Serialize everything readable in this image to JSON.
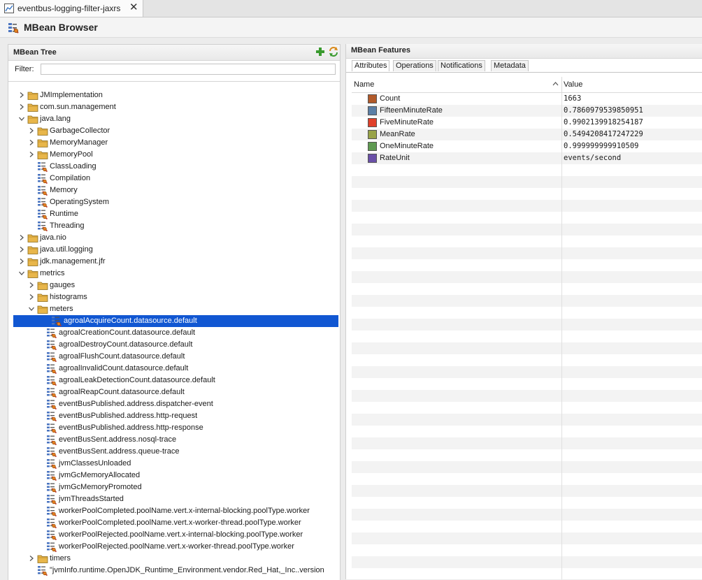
{
  "editor_tab": {
    "title": "eventbus-logging-filter-jaxrs",
    "close": "✕"
  },
  "page": {
    "title": "MBean Browser"
  },
  "mbean_tree": {
    "header": "MBean Tree",
    "filter_label": "Filter:",
    "filter_value": "",
    "rows": [
      {
        "label": "JMImplementation",
        "depth": 1,
        "kind": "folder",
        "twisty": "collapsed"
      },
      {
        "label": "com.sun.management",
        "depth": 1,
        "kind": "folder",
        "twisty": "collapsed"
      },
      {
        "label": "java.lang",
        "depth": 1,
        "kind": "folder",
        "twisty": "expanded"
      },
      {
        "label": "GarbageCollector",
        "depth": 2,
        "kind": "folder",
        "twisty": "collapsed"
      },
      {
        "label": "MemoryManager",
        "depth": 2,
        "kind": "folder",
        "twisty": "collapsed"
      },
      {
        "label": "MemoryPool",
        "depth": 2,
        "kind": "folder",
        "twisty": "collapsed"
      },
      {
        "label": "ClassLoading",
        "depth": 2,
        "kind": "bean",
        "twisty": "none"
      },
      {
        "label": "Compilation",
        "depth": 2,
        "kind": "bean",
        "twisty": "none"
      },
      {
        "label": "Memory",
        "depth": 2,
        "kind": "bean",
        "twisty": "none"
      },
      {
        "label": "OperatingSystem",
        "depth": 2,
        "kind": "bean",
        "twisty": "none"
      },
      {
        "label": "Runtime",
        "depth": 2,
        "kind": "bean",
        "twisty": "none"
      },
      {
        "label": "Threading",
        "depth": 2,
        "kind": "bean",
        "twisty": "none"
      },
      {
        "label": "java.nio",
        "depth": 1,
        "kind": "folder",
        "twisty": "collapsed"
      },
      {
        "label": "java.util.logging",
        "depth": 1,
        "kind": "folder",
        "twisty": "collapsed"
      },
      {
        "label": "jdk.management.jfr",
        "depth": 1,
        "kind": "folder",
        "twisty": "collapsed"
      },
      {
        "label": "metrics",
        "depth": 1,
        "kind": "folder",
        "twisty": "expanded"
      },
      {
        "label": "gauges",
        "depth": 2,
        "kind": "folder",
        "twisty": "collapsed"
      },
      {
        "label": "histograms",
        "depth": 2,
        "kind": "folder",
        "twisty": "collapsed"
      },
      {
        "label": "meters",
        "depth": 2,
        "kind": "folder",
        "twisty": "expanded"
      },
      {
        "label": "agroalAcquireCount.datasource.default",
        "depth": 3,
        "kind": "bean",
        "twisty": "none",
        "selected": true
      },
      {
        "label": "agroalCreationCount.datasource.default",
        "depth": 3,
        "kind": "bean",
        "twisty": "none"
      },
      {
        "label": "agroalDestroyCount.datasource.default",
        "depth": 3,
        "kind": "bean",
        "twisty": "none"
      },
      {
        "label": "agroalFlushCount.datasource.default",
        "depth": 3,
        "kind": "bean",
        "twisty": "none"
      },
      {
        "label": "agroalInvalidCount.datasource.default",
        "depth": 3,
        "kind": "bean",
        "twisty": "none"
      },
      {
        "label": "agroalLeakDetectionCount.datasource.default",
        "depth": 3,
        "kind": "bean",
        "twisty": "none"
      },
      {
        "label": "agroalReapCount.datasource.default",
        "depth": 3,
        "kind": "bean",
        "twisty": "none"
      },
      {
        "label": "eventBusPublished.address.dispatcher-event",
        "depth": 3,
        "kind": "bean",
        "twisty": "none"
      },
      {
        "label": "eventBusPublished.address.http-request",
        "depth": 3,
        "kind": "bean",
        "twisty": "none"
      },
      {
        "label": "eventBusPublished.address.http-response",
        "depth": 3,
        "kind": "bean",
        "twisty": "none"
      },
      {
        "label": "eventBusSent.address.nosql-trace",
        "depth": 3,
        "kind": "bean",
        "twisty": "none"
      },
      {
        "label": "eventBusSent.address.queue-trace",
        "depth": 3,
        "kind": "bean",
        "twisty": "none"
      },
      {
        "label": "jvmClassesUnloaded",
        "depth": 3,
        "kind": "bean",
        "twisty": "none"
      },
      {
        "label": "jvmGcMemoryAllocated",
        "depth": 3,
        "kind": "bean",
        "twisty": "none"
      },
      {
        "label": "jvmGcMemoryPromoted",
        "depth": 3,
        "kind": "bean",
        "twisty": "none"
      },
      {
        "label": "jvmThreadsStarted",
        "depth": 3,
        "kind": "bean",
        "twisty": "none"
      },
      {
        "label": "workerPoolCompleted.poolName.vert.x-internal-blocking.poolType.worker",
        "depth": 3,
        "kind": "bean",
        "twisty": "none"
      },
      {
        "label": "workerPoolCompleted.poolName.vert.x-worker-thread.poolType.worker",
        "depth": 3,
        "kind": "bean",
        "twisty": "none"
      },
      {
        "label": "workerPoolRejected.poolName.vert.x-internal-blocking.poolType.worker",
        "depth": 3,
        "kind": "bean",
        "twisty": "none"
      },
      {
        "label": "workerPoolRejected.poolName.vert.x-worker-thread.poolType.worker",
        "depth": 3,
        "kind": "bean",
        "twisty": "none"
      },
      {
        "label": "timers",
        "depth": 2,
        "kind": "folder",
        "twisty": "collapsed"
      },
      {
        "label": "\"jvmInfo.runtime.OpenJDK_Runtime_Environment.vendor.Red_Hat,_Inc..version",
        "depth": 2,
        "kind": "bean",
        "twisty": "none"
      }
    ]
  },
  "features": {
    "header": "MBean Features",
    "tabs": [
      "Attributes",
      "Operations",
      "Notifications",
      "Metadata"
    ],
    "active_tab": "Attributes",
    "columns": {
      "name": "Name",
      "value": "Value"
    },
    "attributes": [
      {
        "name": "Count",
        "value": "1663",
        "color": "#b25a2a"
      },
      {
        "name": "FifteenMinuteRate",
        "value": "0.7860979539850951",
        "color": "#5b7fa6"
      },
      {
        "name": "FiveMinuteRate",
        "value": "0.9902139918254187",
        "color": "#e0402a"
      },
      {
        "name": "MeanRate",
        "value": "0.5494208417247229",
        "color": "#98a347"
      },
      {
        "name": "OneMinuteRate",
        "value": "0.999999999910509",
        "color": "#5f9a52"
      },
      {
        "name": "RateUnit",
        "value": "events/second",
        "color": "#6a4fa8"
      }
    ]
  },
  "colors": {
    "selection": "#1157d2",
    "folder": "#e8b64a"
  }
}
